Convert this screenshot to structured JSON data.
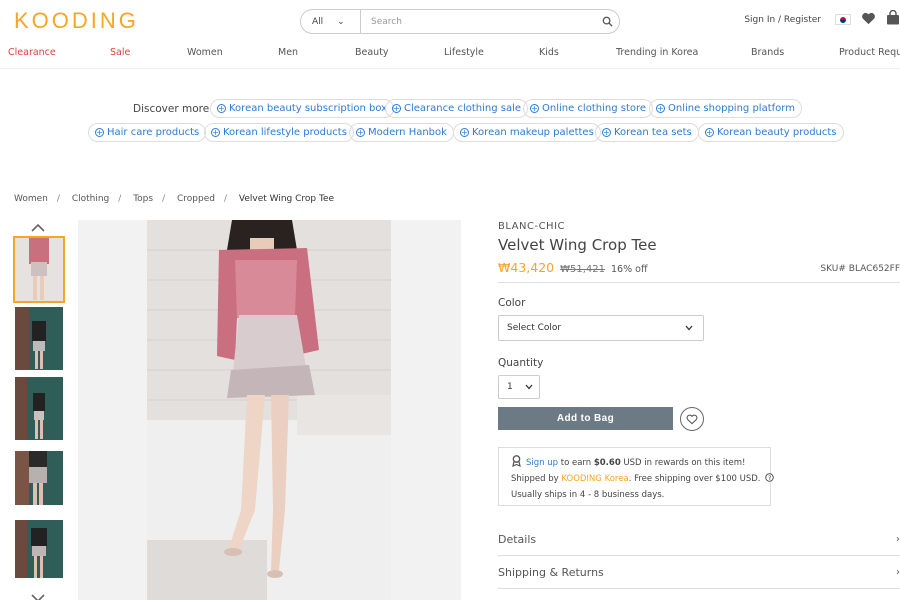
{
  "header": {
    "logo": "KOODING",
    "search_scope": "All",
    "search_placeholder": "Search",
    "signin_label": "Sign In / Register"
  },
  "nav": [
    "Clearance",
    "Sale",
    "Women",
    "Men",
    "Beauty",
    "Lifestyle",
    "Kids",
    "Trending in Korea",
    "Brands",
    "Product Reque"
  ],
  "discover": {
    "label": "Discover more",
    "row1": [
      "Korean beauty subscription box",
      "Clearance clothing sale",
      "Online clothing store",
      "Online shopping platform"
    ],
    "row2": [
      "Hair care products",
      "Korean lifestyle products",
      "Modern Hanbok",
      "Korean makeup palettes",
      "Korean tea sets",
      "Korean beauty products"
    ]
  },
  "breadcrumb": [
    "Women",
    "Clothing",
    "Tops",
    "Cropped",
    "Velvet Wing Crop Tee"
  ],
  "product": {
    "brand": "BLANC-CHIC",
    "title": "Velvet Wing Crop Tee",
    "price": "₩43,420",
    "old_price": "₩51,421",
    "discount": "16% off",
    "sku": "SKU# BLAC652FF",
    "color_label": "Color",
    "color_value": "Select Color",
    "quantity_label": "Quantity",
    "quantity_value": "1",
    "add_to_bag": "Add to Bag"
  },
  "info": {
    "signup_link": "Sign up",
    "signup_text": " to earn ",
    "reward": "$0.60",
    "reward_tail": " USD in rewards on this item!",
    "shipped_by": "Shipped by ",
    "shipper": "KOODING Korea",
    "shipping_tail": ". Free shipping over $100 USD.",
    "ships_in": "Usually ships in 4 - 8 business days."
  },
  "accordions": [
    "Details",
    "Shipping & Returns"
  ],
  "colors": {
    "accent": "#f5a623",
    "link": "#2a7bd4",
    "sale": "#e03e3e",
    "button": "#6c7a86"
  }
}
